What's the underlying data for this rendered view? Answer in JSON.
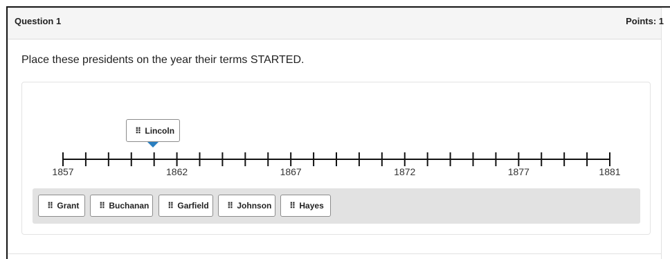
{
  "question": {
    "title": "Question 1",
    "points": "Points: 1",
    "prompt": "Place these presidents on the year their terms STARTED."
  },
  "timeline": {
    "start_year": 1857,
    "end_year": 1881,
    "tick_labels": [
      "1857",
      "1862",
      "1867",
      "1872",
      "1877",
      "1881"
    ]
  },
  "placed": [
    {
      "label": "Lincoln",
      "year": 1861
    }
  ],
  "bank": {
    "items": [
      "Grant",
      "Buchanan",
      "Garfield",
      "Johnson",
      "Hayes"
    ]
  },
  "icons": {
    "grip": "drag-handle-icon",
    "pointer": "pointer-icon"
  },
  "colors": {
    "pointer": "#2a7fc0",
    "bank_bg": "#e2e2e2",
    "header_bg": "#f5f5f5"
  }
}
